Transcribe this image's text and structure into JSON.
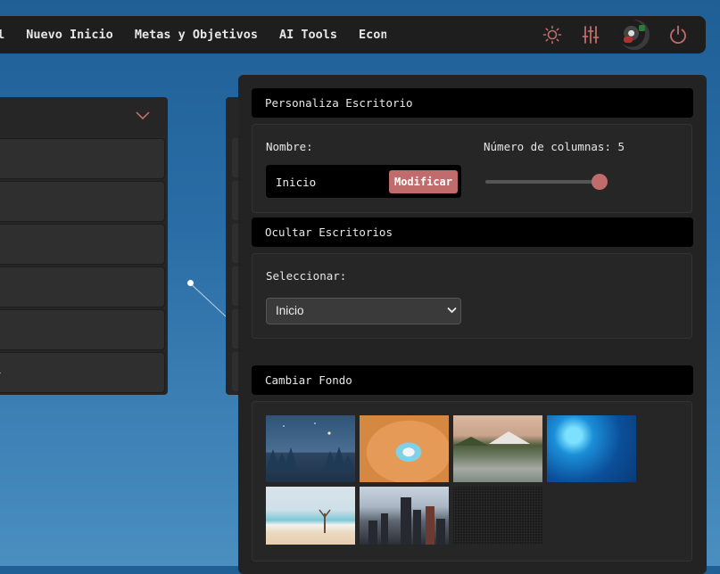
{
  "navbar": {
    "items": [
      "al",
      "Nuevo Inicio",
      "Metas y Objetivos",
      "AI Tools",
      "Economía"
    ],
    "icons": [
      "sun-icon",
      "sliders-icon",
      "avatar",
      "power-icon"
    ],
    "accent": "#c16c6c"
  },
  "personaliza": {
    "title": "Personaliza Escritorio",
    "name_label": "Nombre:",
    "name_value": "Inicio",
    "modify_label": "Modificar",
    "columns_label": "Número de columnas: 5",
    "columns_value": 5,
    "columns_max": 5
  },
  "ocultar": {
    "title": "Ocultar Escritorios",
    "select_label": "Seleccionar:",
    "selected": "Inicio"
  },
  "fondo": {
    "title": "Cambiar Fondo",
    "backgrounds": [
      "night-forest",
      "surf",
      "mountain-lake",
      "ocean",
      "beach",
      "city",
      "dark-texture"
    ]
  }
}
